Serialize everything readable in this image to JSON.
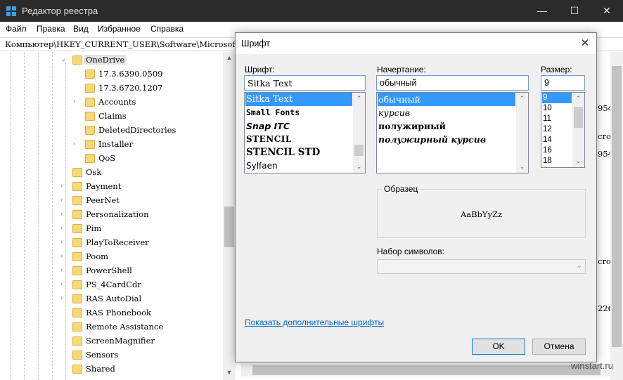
{
  "window": {
    "title": "Редактор реестра",
    "minimize": "—",
    "maximize": "☐",
    "close": "✕"
  },
  "menu": [
    "Файл",
    "Правка",
    "Вид",
    "Избранное",
    "Справка"
  ],
  "address": "Компьютер\\HKEY_CURRENT_USER\\Software\\Microsoft",
  "tree": {
    "items": [
      {
        "label": "OneDrive",
        "expander": "⌄",
        "selected": true
      },
      {
        "label": "17.3.6390.0509",
        "expander": ""
      },
      {
        "label": "17.3.6720.1207",
        "expander": ""
      },
      {
        "label": "Accounts",
        "expander": "›"
      },
      {
        "label": "Claims",
        "expander": ""
      },
      {
        "label": "DeletedDirectories",
        "expander": ""
      },
      {
        "label": "Installer",
        "expander": "›"
      },
      {
        "label": "QoS",
        "expander": ""
      },
      {
        "label": "Osk",
        "expander": ""
      },
      {
        "label": "Payment",
        "expander": "›"
      },
      {
        "label": "PeerNet",
        "expander": "›"
      },
      {
        "label": "Personalization",
        "expander": "›"
      },
      {
        "label": "Pim",
        "expander": "›"
      },
      {
        "label": "PlayToReceiver",
        "expander": "›"
      },
      {
        "label": "Poom",
        "expander": "›"
      },
      {
        "label": "PowerShell",
        "expander": "›"
      },
      {
        "label": "PS_4CardCdr",
        "expander": "›"
      },
      {
        "label": "RAS AutoDial",
        "expander": "›"
      },
      {
        "label": "RAS Phonebook",
        "expander": ""
      },
      {
        "label": "Remote Assistance",
        "expander": ""
      },
      {
        "label": "ScreenMagnifier",
        "expander": ""
      },
      {
        "label": "Sensors",
        "expander": ""
      },
      {
        "label": "Shared",
        "expander": ""
      }
    ]
  },
  "right_panel_fragments": [
    "954",
    "cros",
    "954",
    "cros",
    "226"
  ],
  "watermark": "winstart.ru",
  "dialog": {
    "title": "Шрифт",
    "close": "✕",
    "font": {
      "label": "Шрифт:",
      "value": "Sitka Text",
      "options": [
        "Sitka Text",
        "Small Fonts",
        "Snap ITC",
        "STENCIL",
        "STENCIL STD",
        "Sylfaen"
      ],
      "selected_index": 0
    },
    "style": {
      "label": "Начертание:",
      "value": "обычный",
      "options": [
        "обычный",
        "курсив",
        "полужирный",
        "полужирный курсив"
      ],
      "selected_index": 0
    },
    "size": {
      "label": "Размер:",
      "value": "9",
      "options": [
        "9",
        "10",
        "11",
        "12",
        "14",
        "16",
        "18"
      ],
      "selected_index": 0
    },
    "sample": {
      "label": "Образец",
      "text": "AaBbYyZz"
    },
    "charset": {
      "label": "Набор символов:",
      "value": ""
    },
    "more_fonts_link": "Показать дополнительные шрифты",
    "ok": "OK",
    "cancel": "Отмена"
  },
  "colors": {
    "titlebar": "#2b2b2b",
    "selection": "#3399ff",
    "link": "#0066cc",
    "folder": "#f8d775"
  }
}
